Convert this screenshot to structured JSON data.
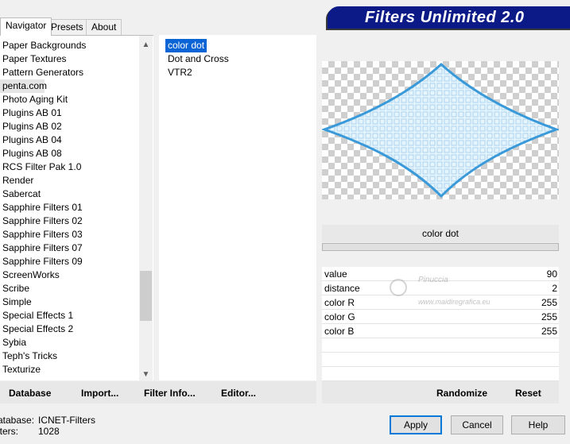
{
  "tabs": [
    {
      "label": "Navigator",
      "active": true
    },
    {
      "label": "Presets",
      "active": false
    },
    {
      "label": "About",
      "active": false
    }
  ],
  "banner": {
    "title": "Filters Unlimited 2.0"
  },
  "categories": [
    "Paper Backgrounds",
    "Paper Textures",
    "Pattern Generators",
    "penta.com",
    "Photo Aging Kit",
    "Plugins AB 01",
    "Plugins AB 02",
    "Plugins AB 04",
    "Plugins AB 08",
    "RCS Filter Pak 1.0",
    "Render",
    "Sabercat",
    "Sapphire Filters 01",
    "Sapphire Filters 02",
    "Sapphire Filters 03",
    "Sapphire Filters 07",
    "Sapphire Filters 09",
    "ScreenWorks",
    "Scribe",
    "Simple",
    "Special Effects 1",
    "Special Effects 2",
    "Sybia",
    "Teph's Tricks",
    "Texturize"
  ],
  "selected_category": "penta.com",
  "filters": [
    "color dot",
    "Dot and Cross",
    "VTR2"
  ],
  "selected_filter": "color dot",
  "filter_title": "color dot",
  "params": [
    {
      "label": "value",
      "value": "90"
    },
    {
      "label": "distance",
      "value": "2"
    },
    {
      "label": "color R",
      "value": "255"
    },
    {
      "label": "color G",
      "value": "255"
    },
    {
      "label": "color B",
      "value": "255"
    }
  ],
  "watermark": {
    "line1": "Pinuccia",
    "line2": "www.maidiregrafica.eu"
  },
  "toolbar": {
    "database": "Database",
    "import": "Import...",
    "filter_info": "Filter Info...",
    "editor": "Editor...",
    "randomize": "Randomize",
    "reset": "Reset"
  },
  "status": {
    "database_label": "atabase:",
    "database_value": "ICNET-Filters",
    "filters_label": "lters:",
    "filters_value": "1028"
  },
  "buttons": {
    "apply": "Apply",
    "cancel": "Cancel",
    "help": "Help"
  },
  "colors": {
    "selection": "#0a64d6",
    "banner": "#0b1a86",
    "apply_border": "#0078d7",
    "preview_stroke": "#3a9ad9"
  }
}
